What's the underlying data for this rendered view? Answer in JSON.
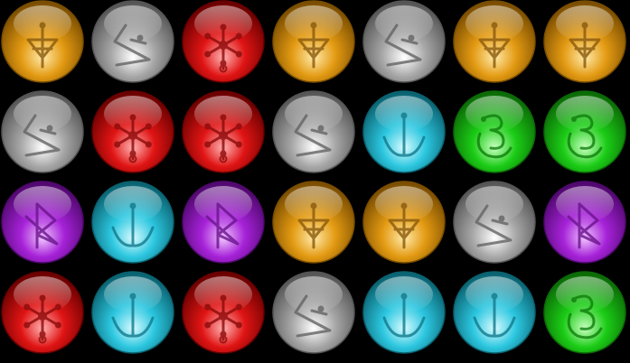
{
  "board": {
    "rows": 4,
    "columns": 7,
    "background": "#000000",
    "cells": [
      [
        "yellow",
        "gray",
        "red",
        "yellow",
        "gray",
        "yellow",
        "yellow"
      ],
      [
        "gray",
        "red",
        "red",
        "gray",
        "cyan",
        "green",
        "green"
      ],
      [
        "purple",
        "cyan",
        "purple",
        "yellow",
        "yellow",
        "gray",
        "purple"
      ],
      [
        "red",
        "cyan",
        "red",
        "gray",
        "cyan",
        "cyan",
        "green"
      ]
    ]
  },
  "gem_types": {
    "yellow": {
      "color": "#e39a12",
      "highlight": "#ffe9a8",
      "rim": "#7a4d00",
      "glyph": "#8a5a0c",
      "symbol": "tree-rune-icon"
    },
    "gray": {
      "color": "#a7a7a7",
      "highlight": "#ffffff",
      "rim": "#555555",
      "glyph": "#646464",
      "symbol": "lightning-rune-icon"
    },
    "red": {
      "color": "#e01414",
      "highlight": "#ffb0b0",
      "rim": "#6a0000",
      "glyph": "#8c0a0a",
      "symbol": "asterisk-rune-icon"
    },
    "cyan": {
      "color": "#2cc7e0",
      "highlight": "#d8fbff",
      "rim": "#0a6270",
      "glyph": "#127a8c",
      "symbol": "anchor-rune-icon"
    },
    "green": {
      "color": "#1bcc16",
      "highlight": "#c8ffc0",
      "rim": "#0b6a06",
      "glyph": "#0f7f0c",
      "symbol": "swirl-rune-icon"
    },
    "purple": {
      "color": "#a622d8",
      "highlight": "#f0c4ff",
      "rim": "#50086e",
      "glyph": "#6a148c",
      "symbol": "flag-rune-icon"
    }
  }
}
